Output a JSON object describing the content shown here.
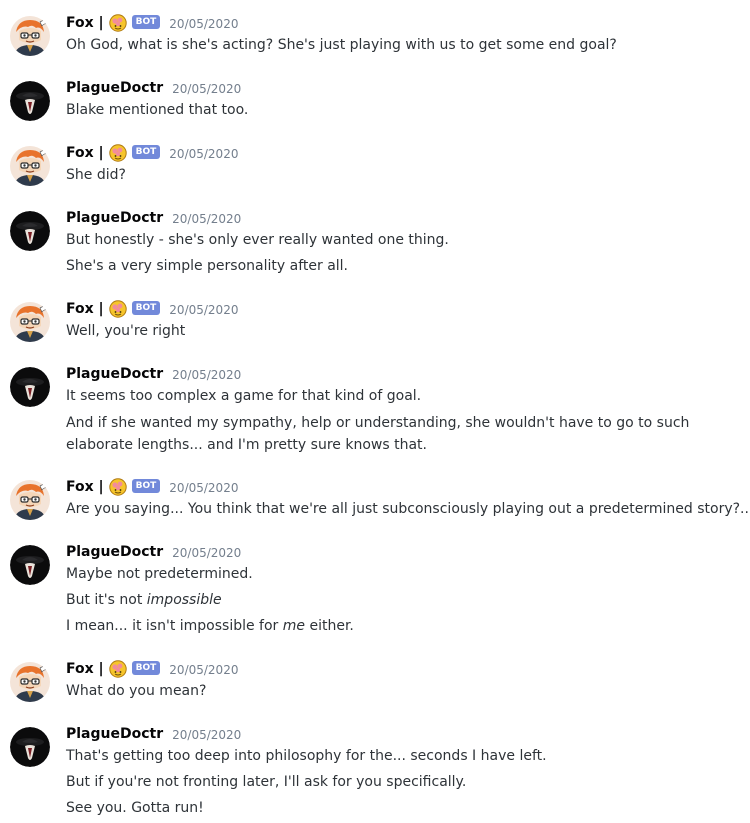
{
  "users": {
    "fox": {
      "name": "Fox |",
      "bot_label": "BOT",
      "emoji_icon": "brain-emoji-icon"
    },
    "plague": {
      "name": "PlagueDoctr"
    }
  },
  "messages": [
    {
      "timestamp": "20/05/2020",
      "lines": [
        "Oh God, what is she's acting? She's just playing with us to get some end goal?"
      ]
    },
    {
      "timestamp": "20/05/2020",
      "lines": [
        "Blake mentioned that too."
      ]
    },
    {
      "timestamp": "20/05/2020",
      "lines": [
        "She did?"
      ]
    },
    {
      "timestamp": "20/05/2020",
      "lines": [
        "But honestly - she's only ever really wanted one thing.",
        "She's a very simple personality after all."
      ]
    },
    {
      "timestamp": "20/05/2020",
      "lines": [
        "Well, you're right"
      ]
    },
    {
      "timestamp": "20/05/2020",
      "lines": [
        "It seems too complex a game for that kind of goal.",
        "And if she wanted my sympathy, help or understanding, she wouldn't have to go to such elaborate lengths... and I'm pretty sure knows that."
      ]
    },
    {
      "timestamp": "20/05/2020",
      "lines": [
        "Are you saying... You think that we're all just subconsciously playing out a predetermined story?..."
      ]
    },
    {
      "timestamp": "20/05/2020",
      "lines": [
        "Maybe not predetermined.",
        "But it's not ",
        "impossible",
        "I mean... it isn't impossible for ",
        "me",
        " either."
      ]
    },
    {
      "timestamp": "20/05/2020",
      "lines": [
        "What do you mean?"
      ]
    },
    {
      "timestamp": "20/05/2020",
      "lines": [
        "That's getting too deep into philosophy for the... seconds I have left.",
        "But if you're not fronting later, I'll ask for you specifically.",
        "See you. Gotta run!"
      ]
    }
  ],
  "colors": {
    "bot_tag": "#7289da",
    "timestamp": "#747f8d",
    "author": "#060607",
    "text": "#2e3338"
  }
}
